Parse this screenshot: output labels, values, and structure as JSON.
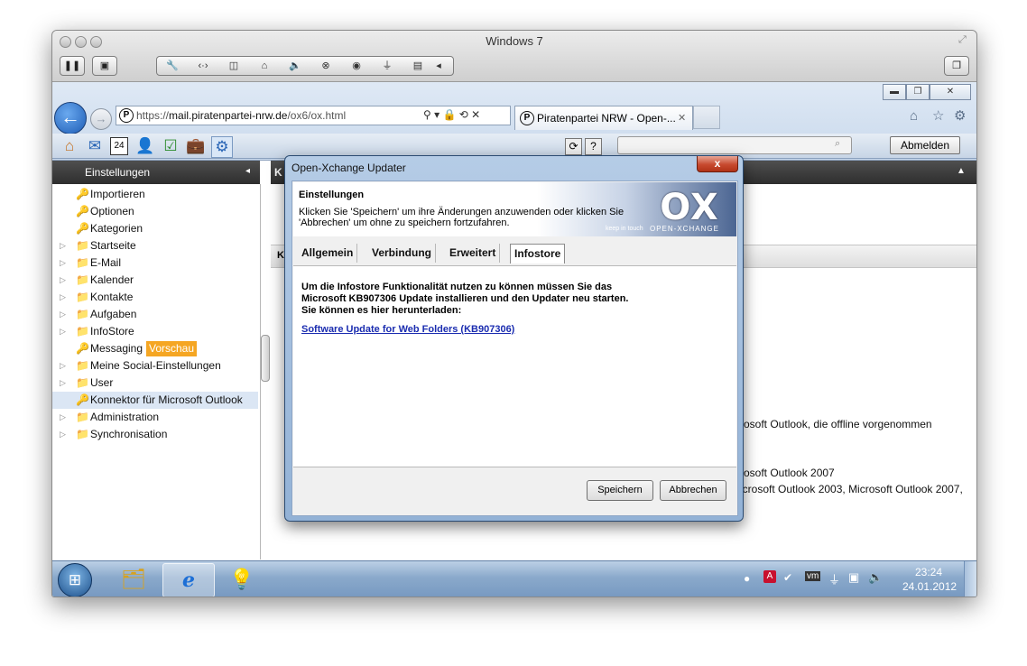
{
  "vm": {
    "title": "Windows 7",
    "toolbar_icons": [
      "pause-icon",
      "snapshot-icon",
      "wrench-icon",
      "arrows-icon",
      "disk-icon",
      "lock-icon",
      "speaker-icon",
      "network-icon",
      "camera-icon",
      "usb-icon",
      "display-icon",
      "window-icon"
    ]
  },
  "browser": {
    "url_prefix": "https://",
    "url_host": "mail.piratenpartei-nrw.de",
    "url_path": "/ox6/ox.html",
    "tab_title": "Piratenpartei NRW - Open-...",
    "tab_close": "✕",
    "search_controls": "⚲ ▾ 🔒 ⟲ ✕"
  },
  "ox": {
    "logout_label": "Abmelden",
    "sidebar_title": "Einstellungen",
    "sidebar_items": [
      {
        "label": "Importieren",
        "expandable": false
      },
      {
        "label": "Optionen",
        "expandable": false
      },
      {
        "label": "Kategorien",
        "expandable": false
      },
      {
        "label": "Startseite",
        "expandable": true
      },
      {
        "label": "E-Mail",
        "expandable": true
      },
      {
        "label": "Kalender",
        "expandable": true
      },
      {
        "label": "Kontakte",
        "expandable": true
      },
      {
        "label": "Aufgaben",
        "expandable": true
      },
      {
        "label": "InfoStore",
        "expandable": true
      },
      {
        "label": "Messaging",
        "expandable": false,
        "badge": "Vorschau"
      },
      {
        "label": "Meine Social-Einstellungen",
        "expandable": true
      },
      {
        "label": "User",
        "expandable": true
      },
      {
        "label": "Konnektor für Microsoft Outlook",
        "expandable": false,
        "selected": true
      },
      {
        "label": "Administration",
        "expandable": true
      },
      {
        "label": "Synchronisation",
        "expandable": true
      }
    ],
    "right_fragments": [
      "rosoft Outlook, die offline vorgenommen",
      "rosoft Outlook 2007",
      "icrosoft Outlook 2003, Microsoft Outlook 2007,"
    ],
    "right_tab_initial": "K",
    "right_head_initial": "K"
  },
  "dialog": {
    "title": "Open-Xchange Updater",
    "close_label": "x",
    "banner_title": "Einstellungen",
    "banner_text": "Klicken Sie 'Speichern' um ihre Änderungen anzuwenden oder klicken Sie 'Abbrechen' um ohne zu speichern fortzufahren.",
    "logo_text": "OX",
    "logo_tag_left": "keep in touch",
    "logo_tag_right": "OPEN-XCHANGE",
    "tabs": [
      "Allgemein",
      "Verbindung",
      "Erweitert",
      "Infostore"
    ],
    "selected_tab": "Infostore",
    "message_lines": [
      "Um die Infostore Funktionalität nutzen zu können müssen Sie das",
      "Microsoft KB907306 Update installieren und den Updater neu starten.",
      "Sie können es hier herunterladen:"
    ],
    "link_text": "Software Update for Web Folders (KB907306)",
    "save_label": "Speichern",
    "cancel_label": "Abbrechen"
  },
  "taskbar": {
    "time": "23:24",
    "date": "24.01.2012"
  },
  "colors": {
    "vorschau_badge": "#f5a623",
    "selected_row": "#dbe6f4",
    "link": "#1b2db0"
  }
}
